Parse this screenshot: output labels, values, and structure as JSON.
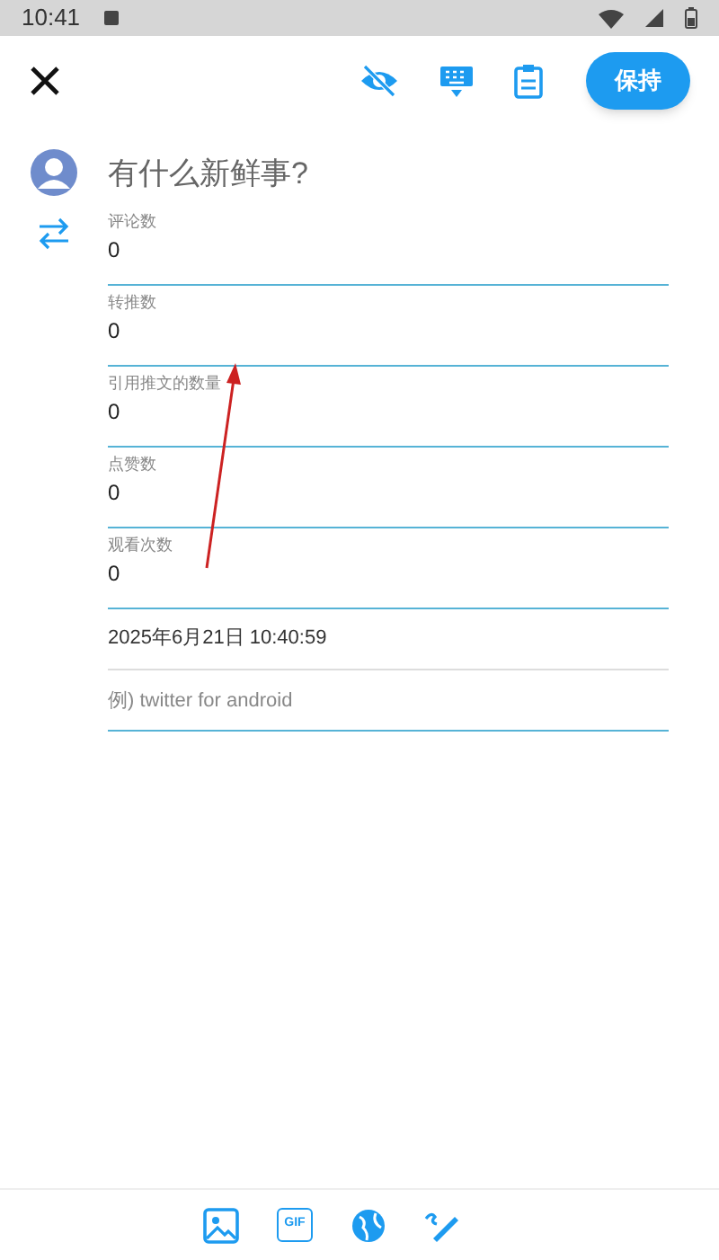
{
  "status_bar": {
    "time": "10:41"
  },
  "header": {
    "save_button": "保持"
  },
  "composer": {
    "placeholder": "有什么新鲜事?"
  },
  "fields": [
    {
      "label": "评论数",
      "value": "0"
    },
    {
      "label": "转推数",
      "value": "0"
    },
    {
      "label": "引用推文的数量",
      "value": "0"
    },
    {
      "label": "点赞数",
      "value": "0"
    },
    {
      "label": "观看次数",
      "value": "0"
    }
  ],
  "date_field": {
    "value": "2025年6月21日 10:40:59"
  },
  "source_field": {
    "placeholder": "例) twitter for android"
  },
  "toolbar": {
    "gif_label": "GIF"
  }
}
